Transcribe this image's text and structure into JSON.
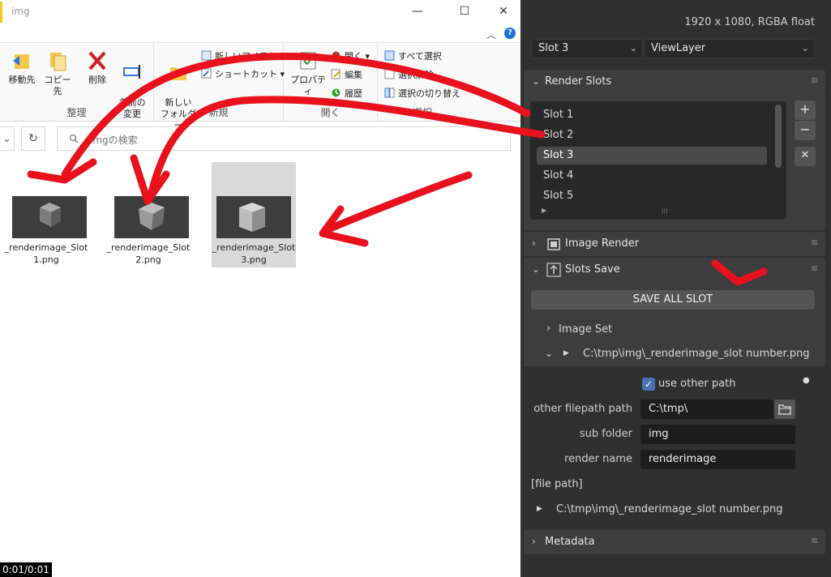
{
  "explorer": {
    "window_title": "img",
    "controls": {
      "minimize": "—",
      "maximize": "☐",
      "close": "✕"
    },
    "ribbon": {
      "groups": [
        {
          "label": "整理",
          "buttons": [
            "移動先",
            "コピー先",
            "削除",
            "名前の\n変更"
          ]
        },
        {
          "label": "新規",
          "big": "新しい\nフォルダー",
          "small": [
            "新しいアイテム ▾",
            "ショートカット ▾"
          ]
        },
        {
          "label": "開く",
          "big": "プロパティ",
          "small": [
            "開く ▾",
            "編集",
            "履歴"
          ]
        },
        {
          "label": "選択",
          "small": [
            "すべて選択",
            "選択解除",
            "選択の切り替え"
          ]
        }
      ]
    },
    "search_placeholder": "imgの検索",
    "files": [
      {
        "name": "_renderimage_Slot 1.png"
      },
      {
        "name": "_renderimage_Slot 2.png"
      },
      {
        "name": "_renderimage_Slot 3.png"
      }
    ],
    "timecode": "0:01/0:01",
    "colors": {
      "annotation": "#e8111c",
      "selected": "#d9d9d9",
      "help": "#1a73d9"
    }
  },
  "blender": {
    "resolution": "1920 x 1080,  RGBA float",
    "slot_select": "Slot 3",
    "layer_select": "ViewLayer",
    "render_slots": {
      "title": "Render Slots",
      "slots": [
        "Slot 1",
        "Slot 2",
        "Slot 3",
        "Slot 4",
        "Slot 5"
      ],
      "active_index": 2,
      "buttons": {
        "add": "+",
        "remove": "−",
        "clear": "✕"
      }
    },
    "image_render": {
      "title": "Image Render"
    },
    "slots_save": {
      "title": "Slots Save",
      "save_all": "SAVE ALL SLOT",
      "image_set": "Image Set",
      "path_preview": "C:\\tmp\\img\\_renderimage_slot number.png",
      "use_other_path_label": "use other path",
      "use_other_path": true,
      "other_filepath_label": "other filepath path",
      "other_filepath": "C:\\tmp\\",
      "sub_folder_label": "sub folder",
      "sub_folder": "img",
      "render_name_label": "render name",
      "render_name": "renderimage",
      "file_path_label": "[file path]",
      "file_path": "C:\\tmp\\img\\_renderimage_slot number.png"
    },
    "metadata": {
      "title": "Metadata"
    },
    "colors": {
      "bg": "#303030",
      "panel": "#3d3d3d",
      "field": "#1d1d1d",
      "check": "#4772b3"
    }
  }
}
